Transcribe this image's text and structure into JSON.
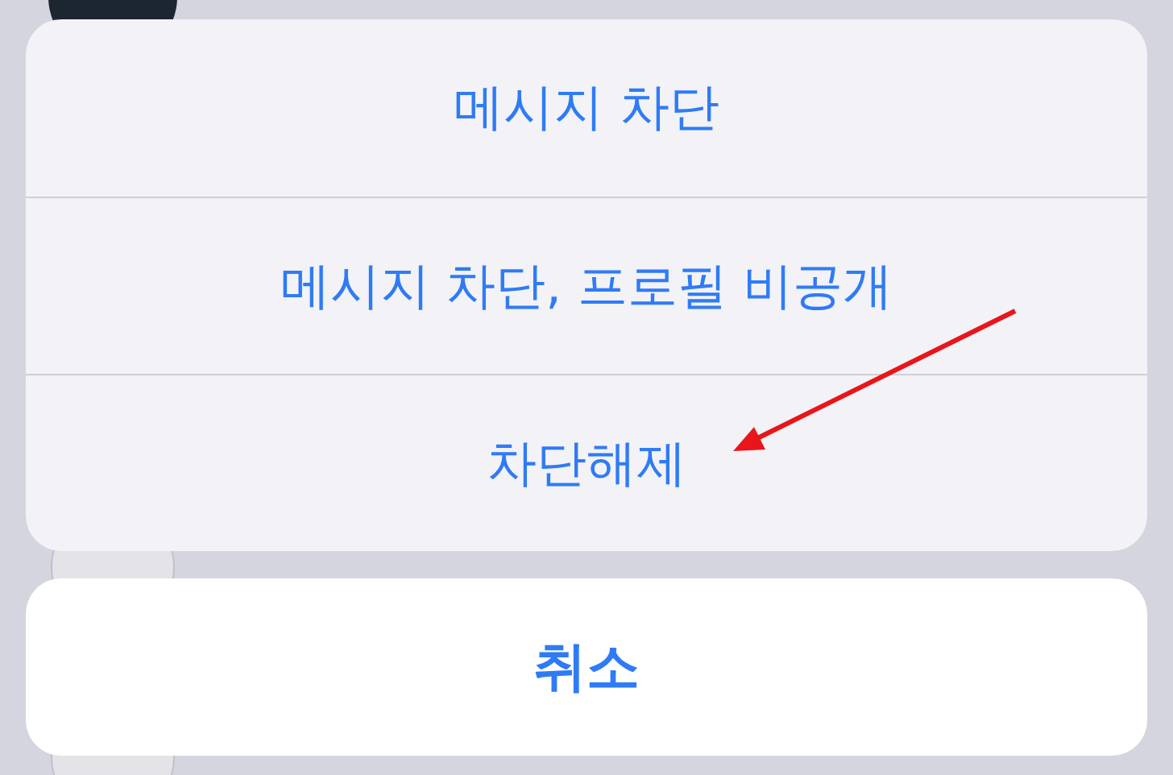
{
  "action_sheet": {
    "actions": [
      {
        "label": "메시지 차단"
      },
      {
        "label": "메시지 차단, 프로필 비공개"
      },
      {
        "label": "차단해제"
      }
    ]
  },
  "cancel_button": {
    "label": "취소"
  }
}
